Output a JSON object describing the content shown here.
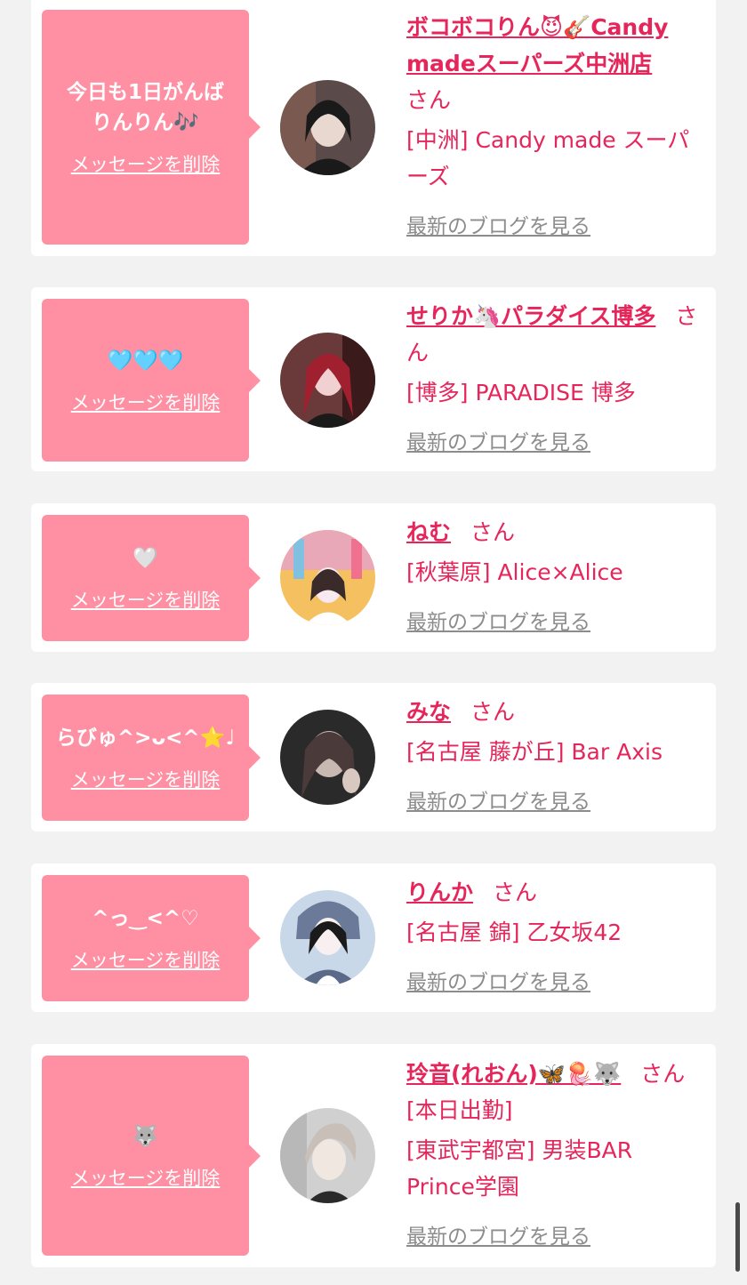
{
  "entries": [
    {
      "message": "今日も1日がんば\nりんりん🎶",
      "delete_label": "メッセージを削除",
      "name": "ボコボコりん😈🎸Candy madeスーパーズ中洲店",
      "honorific": "さん",
      "shop": "[中洲] Candy made スーパーズ",
      "blog_label": "最新のブログを見る",
      "avatar_colors": [
        "#5a4a4a",
        "#e8d8d0",
        "#1a1a1a"
      ]
    },
    {
      "message": "🩵🩵🩵",
      "delete_label": "メッセージを削除",
      "name": "せりか🦄パラダイス博多",
      "honorific": "さん",
      "shop": "[博多] PARADISE 博多",
      "blog_label": "最新のブログを見る",
      "avatar_colors": [
        "#6a3a3a",
        "#f0d0d0",
        "#a02030"
      ]
    },
    {
      "message": "🤍",
      "delete_label": "メッセージを削除",
      "name": "ねむ",
      "honorific": "さん",
      "shop": "[秋葉原] Alice×Alice",
      "blog_label": "最新のブログを見る",
      "avatar_colors": [
        "#f5c060",
        "#f8e8f0",
        "#3a2a2a"
      ]
    },
    {
      "message": "らびゅ^>ᴗ<^⭐️♩",
      "delete_label": "メッセージを削除",
      "name": "みな",
      "honorific": "さん",
      "shop": "[名古屋 藤が丘] Bar Axis",
      "blog_label": "最新のブログを見る",
      "avatar_colors": [
        "#2a2a2a",
        "#d8c8c0",
        "#4a3a3a"
      ]
    },
    {
      "message": "^っ‿<^♡",
      "delete_label": "メッセージを削除",
      "name": "りんか",
      "honorific": "さん",
      "shop": "[名古屋 錦] 乙女坂42",
      "blog_label": "最新のブログを見る",
      "avatar_colors": [
        "#c8d8e8",
        "#f8f0f0",
        "#1a1a1a"
      ]
    },
    {
      "message": "🐺",
      "delete_label": "メッセージを削除",
      "name": "玲音(れおん)🦋🪼🐺",
      "honorific": "さん",
      "extra": "[本日出勤]",
      "shop": "[東武宇都宮] 男装BAR Prince学園",
      "blog_label": "最新のブログを見る",
      "avatar_colors": [
        "#d0d0d0",
        "#f0e8e0",
        "#c8c0b8"
      ]
    }
  ]
}
